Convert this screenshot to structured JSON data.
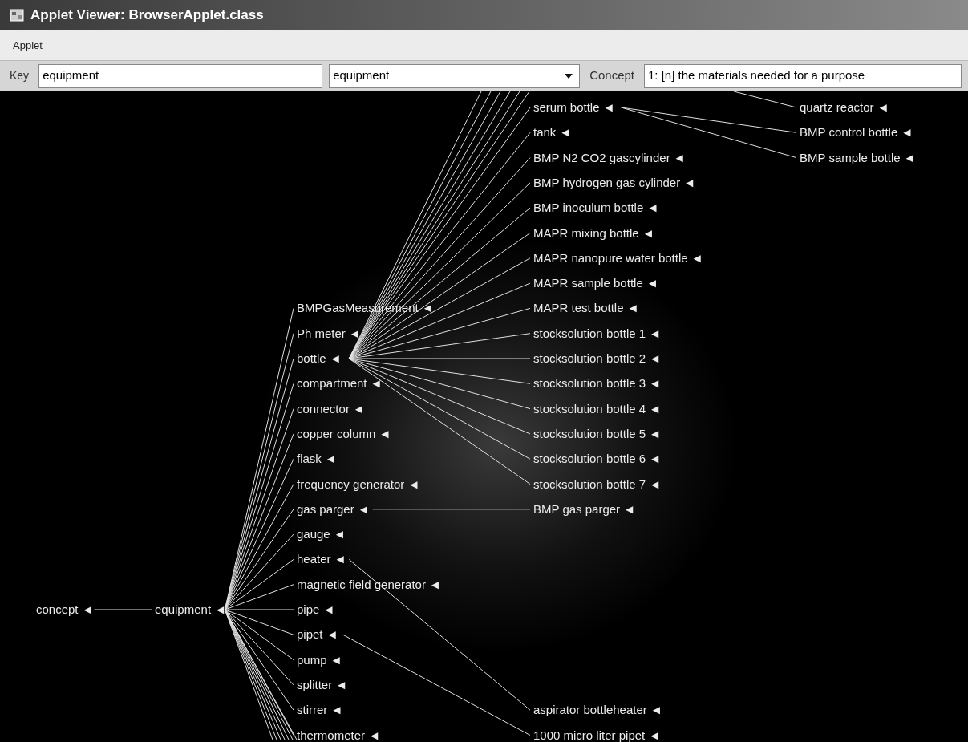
{
  "window": {
    "title": "Applet Viewer: BrowserApplet.class"
  },
  "menu": [
    {
      "label": "Applet"
    }
  ],
  "toolbar": {
    "key_label": "Key",
    "key_value": "equipment",
    "combo_value": "equipment",
    "concept_label": "Concept",
    "concept_value": "1: [n] the materials needed for a purpose"
  },
  "graph": {
    "tree": {
      "label": "concept ◄",
      "children": [
        {
          "label": "equipment ◄",
          "children": [
            {
              "label": "BMPGasMeasurement ◄"
            },
            {
              "label": "Ph meter ◄"
            },
            {
              "label": "bottle ◄",
              "children": [
                {
                  "label": "serum bottle ◄",
                  "children": [
                    {
                      "label": "BMP control bottle ◄"
                    },
                    {
                      "label": "BMP sample bottle ◄"
                    }
                  ]
                },
                {
                  "label": "tank ◄"
                },
                {
                  "label": "BMP N2 CO2 gascylinder ◄"
                },
                {
                  "label": "BMP hydrogen gas cylinder ◄"
                },
                {
                  "label": "BMP inoculum bottle ◄"
                },
                {
                  "label": "MAPR mixing bottle ◄"
                },
                {
                  "label": "MAPR nanopure water bottle ◄"
                },
                {
                  "label": "MAPR sample bottle ◄"
                },
                {
                  "label": "MAPR test bottle ◄"
                },
                {
                  "label": "stocksolution bottle 1 ◄"
                },
                {
                  "label": "stocksolution bottle 2 ◄"
                },
                {
                  "label": "stocksolution bottle 3 ◄"
                },
                {
                  "label": "stocksolution bottle 4 ◄"
                },
                {
                  "label": "stocksolution bottle 5 ◄"
                },
                {
                  "label": "stocksolution bottle 6 ◄"
                },
                {
                  "label": "stocksolution bottle 7 ◄"
                }
              ]
            },
            {
              "label": "compartment ◄"
            },
            {
              "label": "connector ◄"
            },
            {
              "label": "copper column ◄"
            },
            {
              "label": "flask ◄"
            },
            {
              "label": "frequency generator ◄"
            },
            {
              "label": "gas parger ◄",
              "children": [
                {
                  "label": "BMP gas parger ◄"
                }
              ]
            },
            {
              "label": "gauge ◄"
            },
            {
              "label": "heater ◄",
              "children": [
                {
                  "label": "aspirator bottleheater ◄"
                }
              ]
            },
            {
              "label": "magnetic field generator ◄"
            },
            {
              "label": "pipe ◄"
            },
            {
              "label": "pipet ◄",
              "children": [
                {
                  "label": "1000 micro liter pipet ◄"
                }
              ]
            },
            {
              "label": "pump ◄"
            },
            {
              "label": "splitter ◄"
            },
            {
              "label": "stirrer ◄"
            },
            {
              "label": "thermometer ◄"
            }
          ]
        }
      ]
    },
    "detached": [
      {
        "label": "quartz reactor ◄"
      }
    ]
  }
}
